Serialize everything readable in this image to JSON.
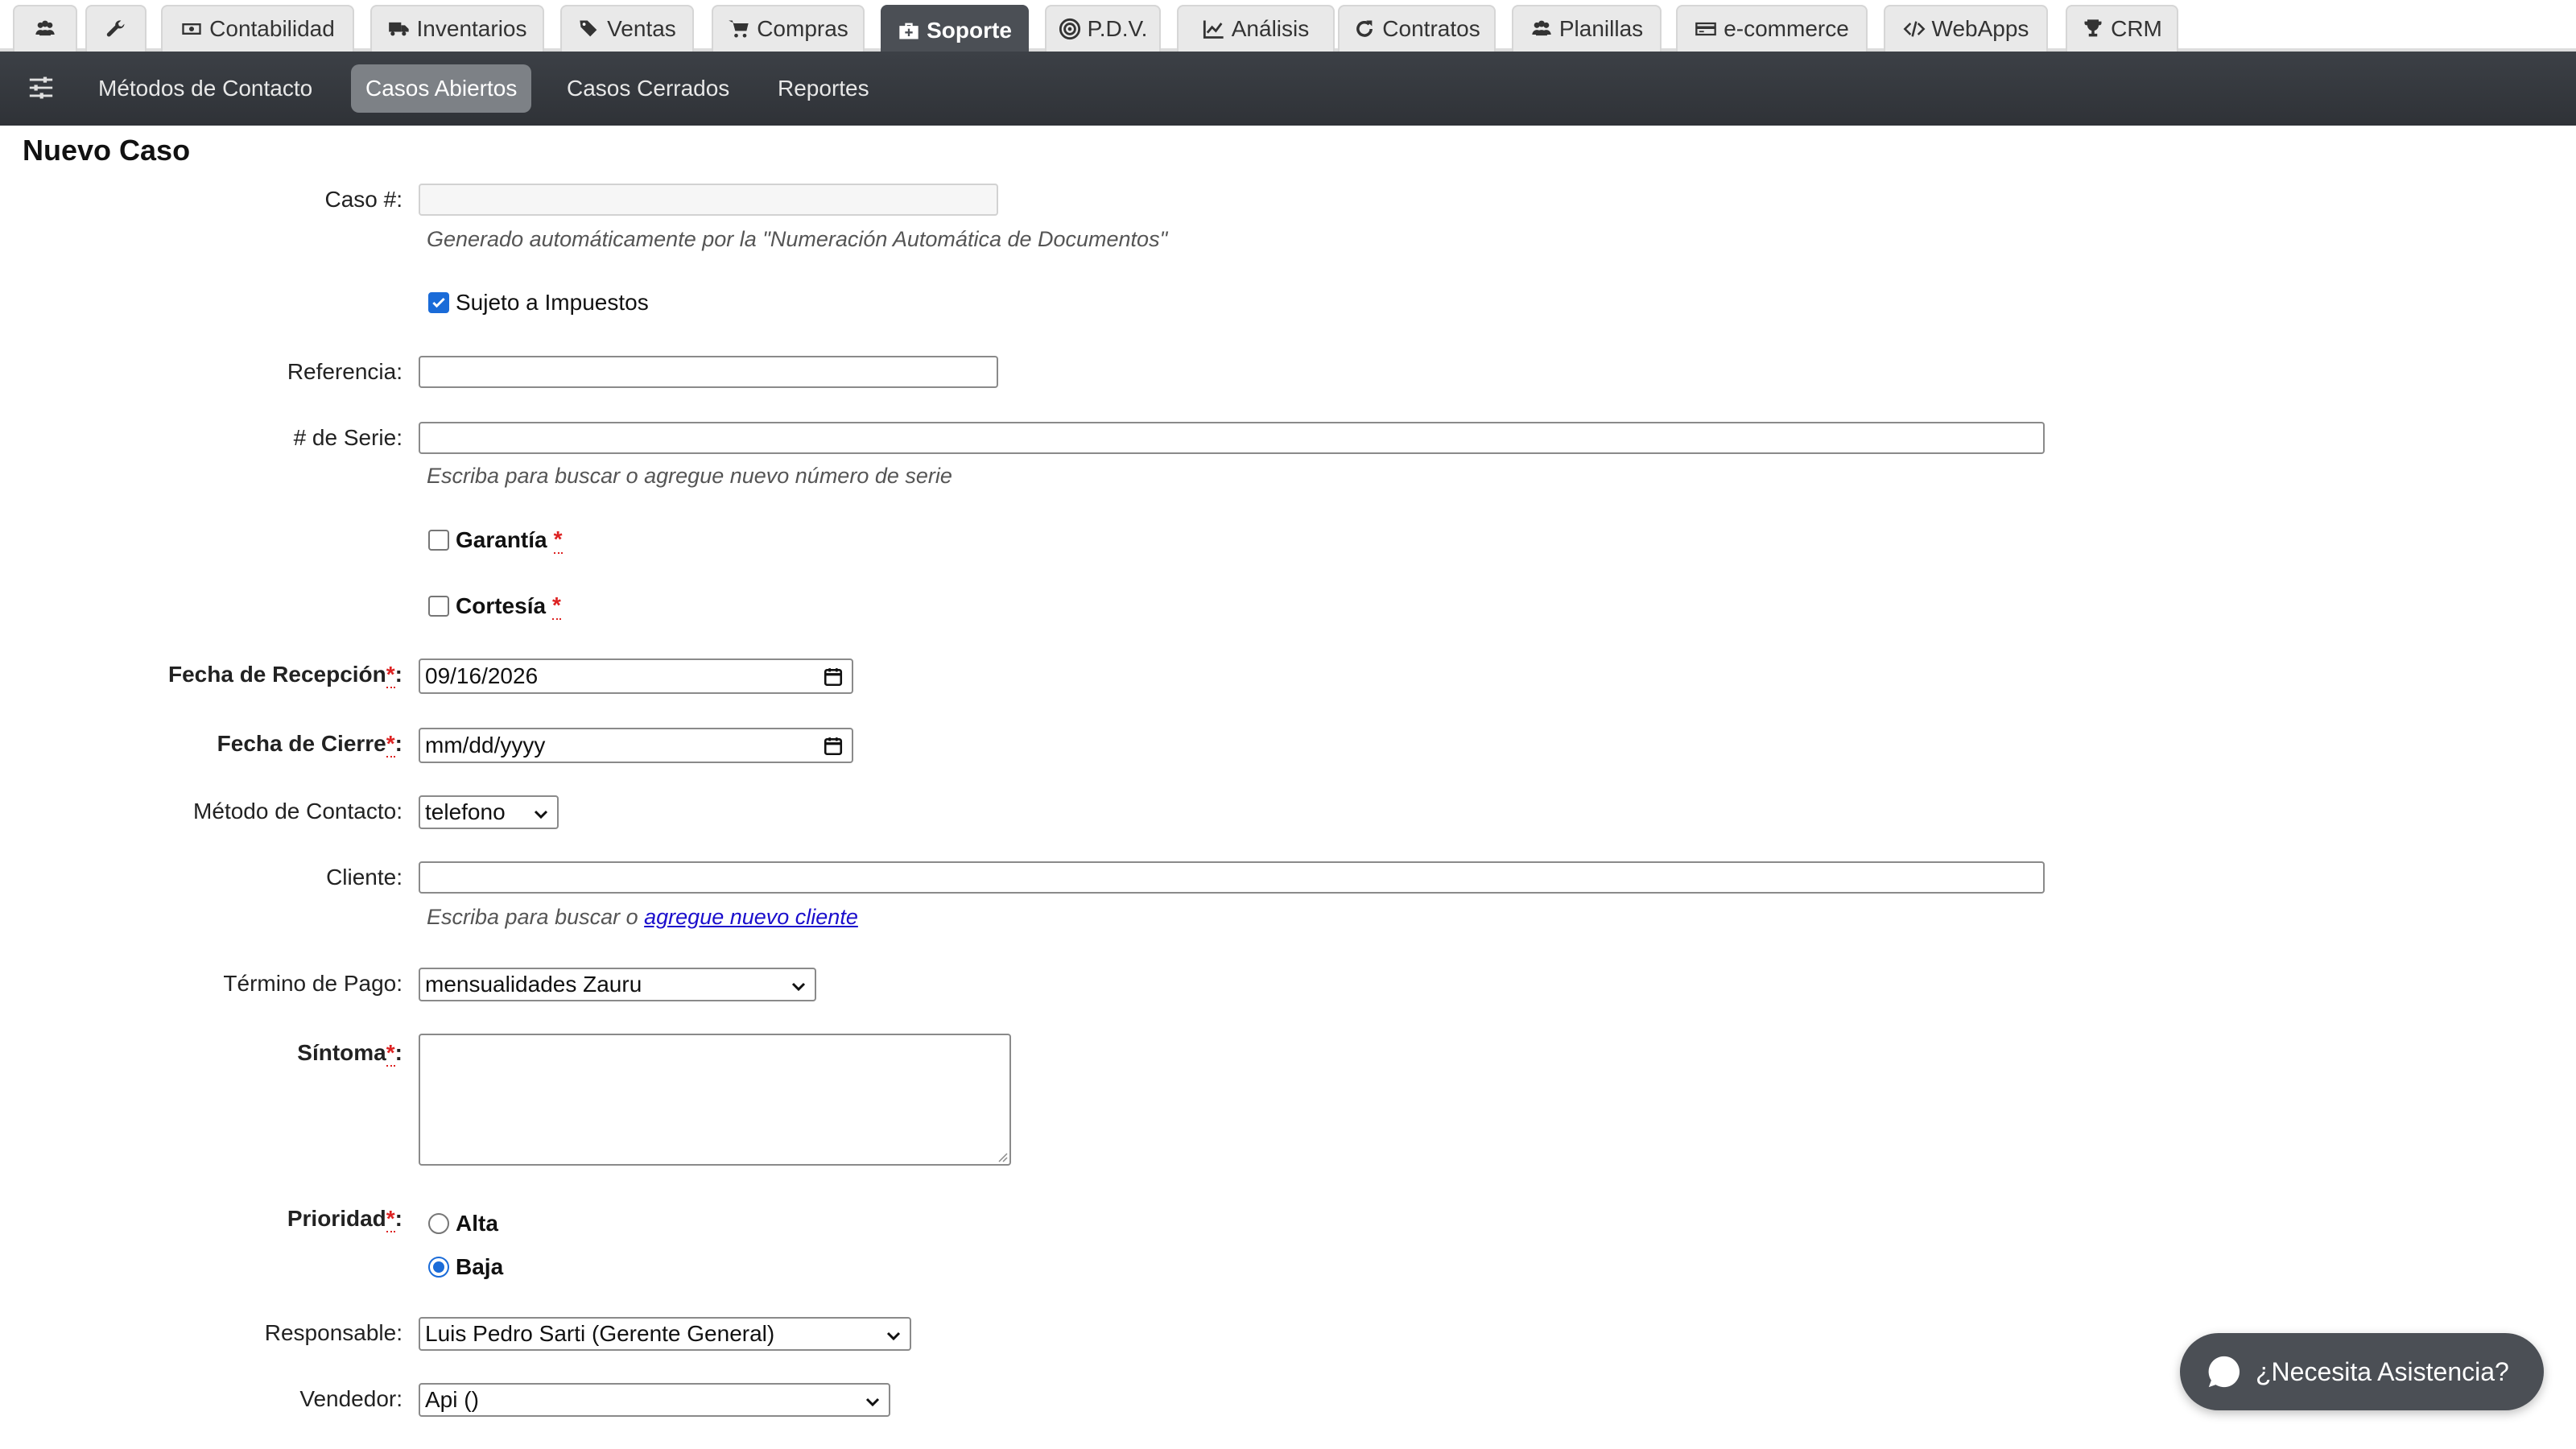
{
  "modules": [
    {
      "icon": "users-icon",
      "label": ""
    },
    {
      "icon": "wrench-icon",
      "label": ""
    },
    {
      "icon": "money-icon",
      "label": "Contabilidad"
    },
    {
      "icon": "truck-icon",
      "label": "Inventarios"
    },
    {
      "icon": "tags-icon",
      "label": "Ventas"
    },
    {
      "icon": "cart-icon",
      "label": "Compras"
    },
    {
      "icon": "medkit-icon",
      "label": "Soporte"
    },
    {
      "icon": "target-icon",
      "label": "P.D.V."
    },
    {
      "icon": "line-chart-icon",
      "label": "Análisis"
    },
    {
      "icon": "refresh-icon",
      "label": "Contratos"
    },
    {
      "icon": "users-icon",
      "label": "Planillas"
    },
    {
      "icon": "credit-card-icon",
      "label": "e-commerce"
    },
    {
      "icon": "code-icon",
      "label": "WebApps"
    },
    {
      "icon": "trophy-icon",
      "label": "CRM"
    }
  ],
  "active_module": "Soporte",
  "subnav": {
    "items": [
      "Métodos de Contacto",
      "Casos Abiertos",
      "Casos Cerrados",
      "Reportes"
    ],
    "active": "Casos Abiertos"
  },
  "form": {
    "title": "Nuevo Caso",
    "caso_label": "Caso #:",
    "caso_hint": "Generado automáticamente por la \"Numeración Automática de Documentos\"",
    "sujeto_label": "Sujeto a Impuestos",
    "sujeto_checked": true,
    "referencia_label": "Referencia:",
    "serie_label": "# de Serie:",
    "serie_hint": "Escriba para buscar o agregue nuevo número de serie",
    "garantia_label": "Garantía",
    "cortesia_label": "Cortesía",
    "recepcion_label": "Fecha de Recepción",
    "recepcion_value": "09/16/2026",
    "cierre_label": "Fecha de Cierre",
    "cierre_value": "mm/dd/yyyy",
    "metodo_label": "Método de Contacto:",
    "metodo_value": "telefono",
    "cliente_label": "Cliente:",
    "cliente_hint_prefix": "Escriba para buscar o ",
    "cliente_hint_link": "agregue nuevo cliente",
    "termino_label": "Término de Pago:",
    "termino_value": "mensualidades Zauru",
    "sintoma_label": "Síntoma",
    "prioridad_label": "Prioridad",
    "prioridad_options": [
      "Alta",
      "Baja"
    ],
    "prioridad_selected": "Baja",
    "responsable_label": "Responsable:",
    "responsable_value": "Luis Pedro Sarti (Gerente General)",
    "vendedor_label": "Vendedor:",
    "vendedor_value": "Api ()",
    "required_mark": "*",
    "colon": ":"
  },
  "assist_label": "¿Necesita Asistencia?",
  "colors": {
    "dark_bar": "#3c4046",
    "active_tab": "#4b4f55",
    "accent": "#1a6bd8",
    "required": "#d22222",
    "link": "#1a0dcc"
  }
}
